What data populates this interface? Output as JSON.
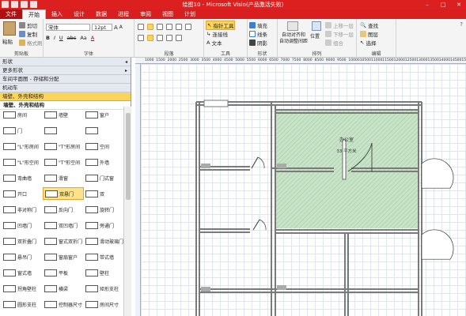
{
  "window": {
    "title": "绘图10 - Microsoft Visio(产品激活失败)"
  },
  "tabs": [
    {
      "label": "文件"
    },
    {
      "label": "开始"
    },
    {
      "label": "插入"
    },
    {
      "label": "设计"
    },
    {
      "label": "数据"
    },
    {
      "label": "进程"
    },
    {
      "label": "审阅"
    },
    {
      "label": "视图"
    },
    {
      "label": "计划"
    }
  ],
  "ribbon": {
    "clipboard": {
      "label": "剪贴板",
      "paste": "粘贴",
      "cut": "剪切",
      "copy": "复制",
      "format_painter": "格式刷"
    },
    "font": {
      "label": "字体",
      "font_name": "宋体",
      "font_size": "12pt",
      "bold": "B",
      "italic": "I",
      "underline": "U",
      "strike": "abc",
      "aa": "Aa"
    },
    "paragraph": {
      "label": "段落"
    },
    "tools": {
      "label": "工具",
      "pointer": "指针工具",
      "connector": "连接线",
      "text": "文本"
    },
    "shape": {
      "label": "形状",
      "fill": "填充",
      "line": "线条",
      "shadow": "阴影"
    },
    "arrange": {
      "label": "排列",
      "align_position": "自动对齐和",
      "auto_align": "自动调整间距",
      "position": "位置",
      "bring_front": "上移一层",
      "send_back": "下移一层",
      "group": "组合"
    },
    "editing": {
      "label": "编辑",
      "find": "查找",
      "layer": "图层",
      "select": "选择"
    }
  },
  "panel": {
    "shapes_header": "形状",
    "more_shapes": "更多形状",
    "stencils": [
      {
        "label": "车间平面图 - 存储和分配"
      },
      {
        "label": "机动车"
      },
      {
        "label": "墙壁、外壳和结构"
      }
    ],
    "section_title": "墙壁、外壳和结构",
    "items": [
      {
        "label": "房间"
      },
      {
        "label": "墙壁"
      },
      {
        "label": "窗户"
      },
      {
        "label": "门"
      },
      {
        "label": ""
      },
      {
        "label": ""
      },
      {
        "label": "\"L\"形房间"
      },
      {
        "label": "\"T\"形房间"
      },
      {
        "label": "空间"
      },
      {
        "label": "\"L\"形空间"
      },
      {
        "label": "\"T\"形空间"
      },
      {
        "label": "外墙"
      },
      {
        "label": "弯曲墙"
      },
      {
        "label": "滑窗"
      },
      {
        "label": "门式窗"
      },
      {
        "label": "开口"
      },
      {
        "label": "双悬门"
      },
      {
        "label": "双"
      },
      {
        "label": "非对称门"
      },
      {
        "label": "反向门"
      },
      {
        "label": "旋转门"
      },
      {
        "label": "凹墙门"
      },
      {
        "label": "双凹墙门"
      },
      {
        "label": "旁通门"
      },
      {
        "label": "双折叠门"
      },
      {
        "label": "窗式双折门"
      },
      {
        "label": "滑动玻璃门"
      },
      {
        "label": "悬吊门"
      },
      {
        "label": "窗扇窗户"
      },
      {
        "label": "带式墙"
      },
      {
        "label": "窗式墙"
      },
      {
        "label": "平板"
      },
      {
        "label": "壁柱"
      },
      {
        "label": "拐角壁柱"
      },
      {
        "label": "横梁"
      },
      {
        "label": "矩形支柱"
      },
      {
        "label": "圆形支柱"
      },
      {
        "label": "控制器尺寸"
      },
      {
        "label": "房间尺寸"
      }
    ],
    "selected_item": "双悬门"
  },
  "ruler": {
    "ticks": [
      "1000",
      "1500",
      "2000",
      "2500",
      "3000",
      "3500",
      "4000",
      "4500",
      "5000",
      "5500",
      "6000",
      "6500",
      "7000",
      "7500",
      "8000",
      "8500",
      "9000",
      "9500",
      "10000",
      "10500",
      "11000",
      "11500",
      "12000",
      "12500",
      "13000",
      "13500",
      "14000",
      "14500",
      "15000"
    ]
  },
  "canvas": {
    "room_label": "办公室",
    "room_area": "33 平方米",
    "room_fill": "#c8e3c8",
    "wall_color": "#7a7a7a"
  }
}
